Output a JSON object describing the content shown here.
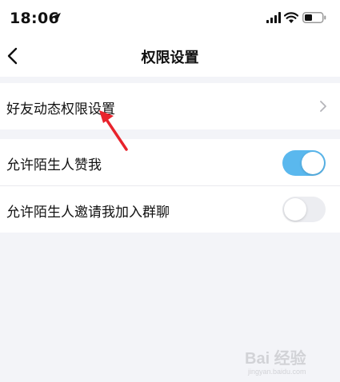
{
  "status_bar": {
    "time": "18:06",
    "icons": [
      "location-arrow-icon",
      "cellular-signal-icon",
      "wifi-icon",
      "battery-icon"
    ]
  },
  "nav": {
    "title": "权限设置",
    "back_icon": "chevron-left-icon"
  },
  "settings": {
    "friend_feed": {
      "label": "好友动态权限设置",
      "icon": "chevron-right-icon"
    },
    "allow_stranger_like": {
      "label": "允许陌生人赞我",
      "enabled": true
    },
    "allow_stranger_invite": {
      "label": "允许陌生人邀请我加入群聊",
      "enabled": false
    }
  },
  "annotation": {
    "icon": "red-arrow-annotation",
    "color": "#e8232c"
  },
  "watermark": {
    "logo": "Bai 经验",
    "sub": "jingyan.baidu.com"
  },
  "colors": {
    "toggle_on": "#5ab8ee",
    "toggle_off": "#ecedf1",
    "background": "#f3f4f8"
  }
}
